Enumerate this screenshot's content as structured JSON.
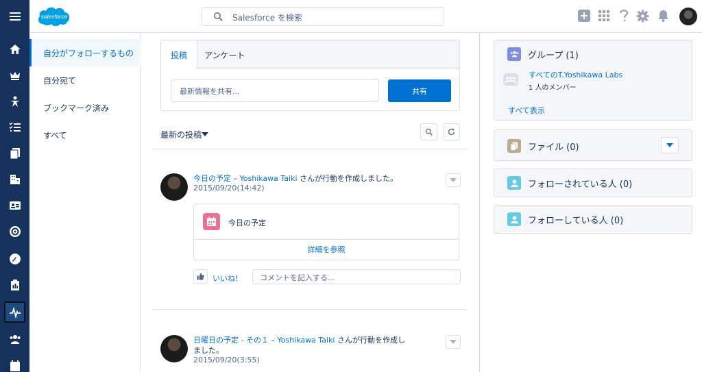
{
  "header": {
    "logo_text": "salesforce",
    "search_placeholder": "Salesforce を検索"
  },
  "subnav": {
    "items": [
      {
        "label": "自分がフォローするもの",
        "active": true
      },
      {
        "label": "自分宛て",
        "active": false
      },
      {
        "label": "ブックマーク済み",
        "active": false
      },
      {
        "label": "すべて",
        "active": false
      }
    ]
  },
  "publisher": {
    "tabs": [
      "投稿",
      "アンケート"
    ],
    "placeholder": "最新情報を共有...",
    "share_label": "共有"
  },
  "feed": {
    "sort_label": "最新の投稿",
    "posts": [
      {
        "event_link": "今日の予定",
        "dash": " – ",
        "author": "Yoshikawa Taiki",
        "action": " さんが行動を作成しました。",
        "date": "2015/09/20(14:42)",
        "card_title": "今日の予定",
        "card_link": "詳細を参照",
        "like_label": "いいね!",
        "comment_placeholder": "コメントを記入する..."
      },
      {
        "event_link": "日曜日の予定 - その１",
        "dash": " – ",
        "author": "Yoshikawa Taiki",
        "action": " さんが行動を作成しました。",
        "date": "2015/09/20(3:55)"
      }
    ]
  },
  "right": {
    "groups": {
      "title": "グループ (1)",
      "group_name": "すべてのT.Yoshikawa Labs",
      "members": "1 人のメンバー",
      "view_all": "すべて表示"
    },
    "files_title": "ファイル (0)",
    "followers_title": "フォローされている人 (0)",
    "following_title": "フォローしている人 (0)"
  },
  "colors": {
    "nav_bg": "#16325c",
    "brand_blue": "#0070d2",
    "logo_blue": "#00a1e0",
    "event_pink": "#eb7092",
    "group_icon": "#7f8de1",
    "file_icon": "#baac93",
    "people_icon": "#65cae4"
  }
}
